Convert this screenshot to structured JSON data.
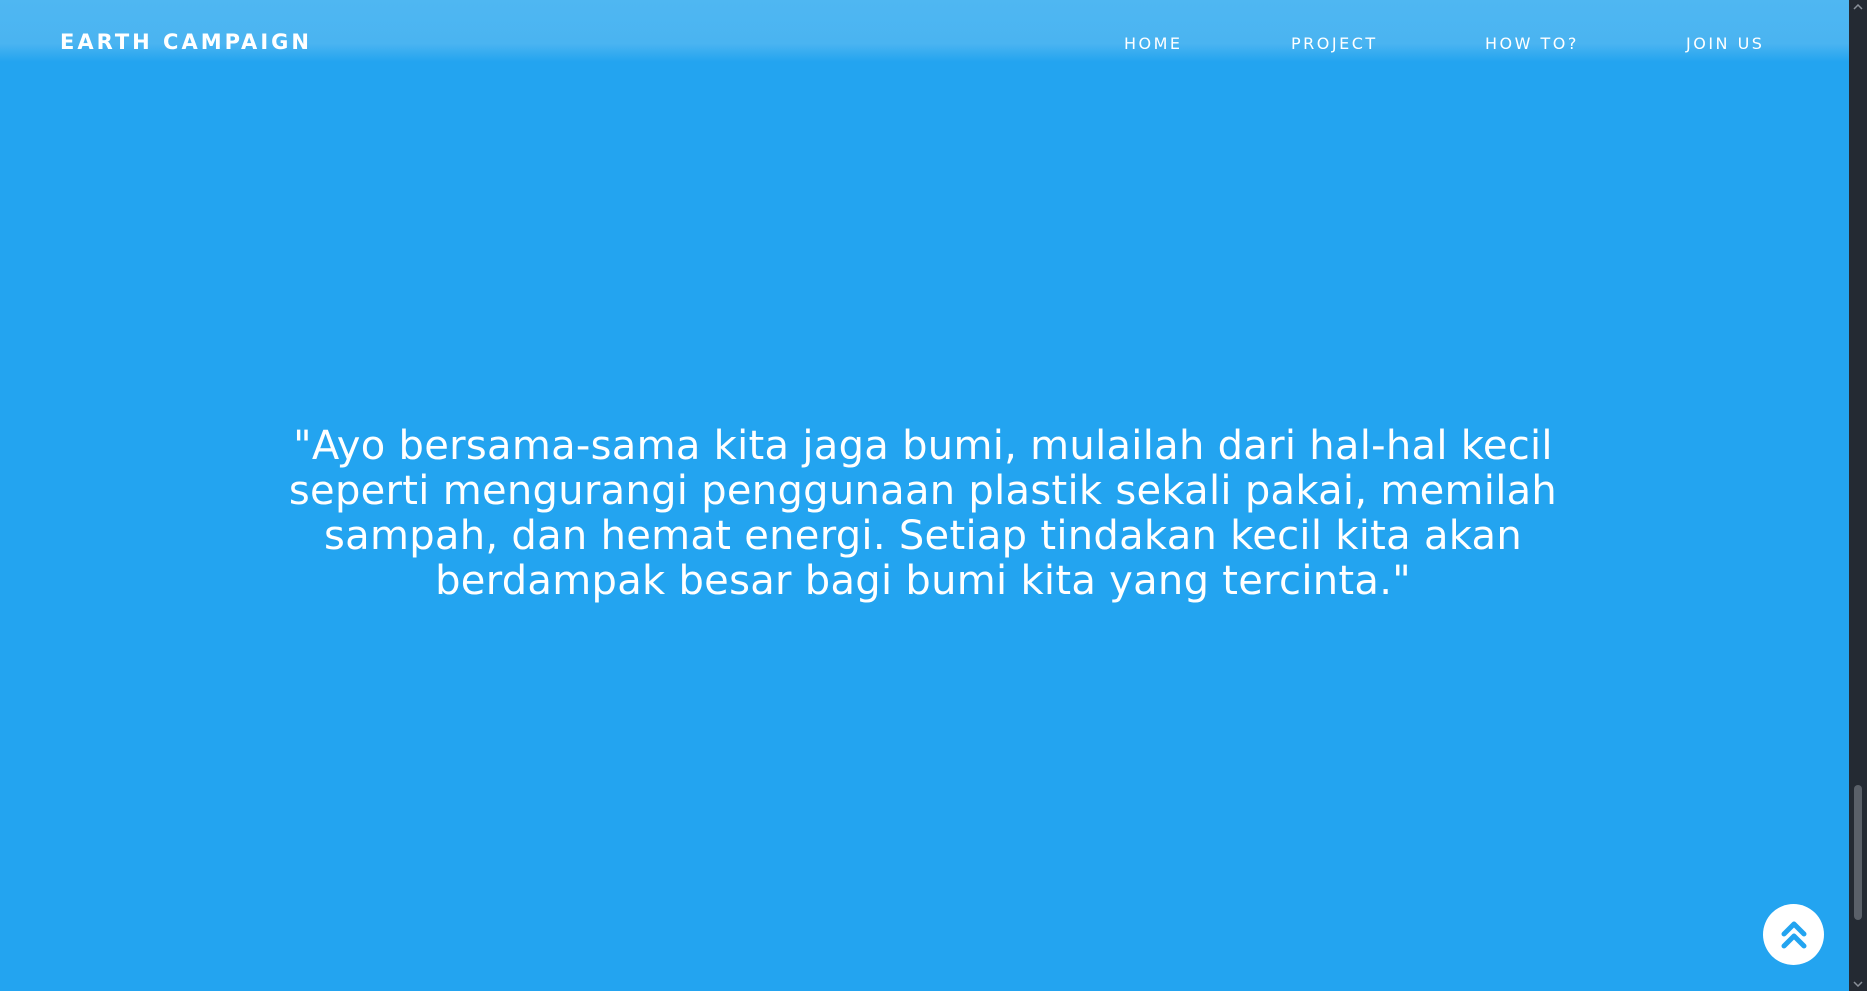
{
  "navbar": {
    "brand": "EARTH CAMPAIGN",
    "links": [
      {
        "label": "HOME"
      },
      {
        "label": "PROJECT"
      },
      {
        "label": "HOW TO?"
      },
      {
        "label": "JOIN US"
      }
    ]
  },
  "main": {
    "quote": "\"Ayo bersama-sama kita jaga bumi, mulailah dari hal-hal kecil seperti mengurangi penggunaan plastik sekali pakai, memilah sampah, dan hemat energi. Setiap tindakan kecil kita akan berdampak besar bagi bumi kita yang tercinta.\""
  },
  "back_to_top": {
    "icon": "double-chevron-up-icon"
  },
  "colors": {
    "background": "#23a4f0",
    "navbar": "#4ab4f1",
    "text": "#ffffff",
    "scrollbar_track": "#242a33",
    "scrollbar_thumb": "#5a6069"
  }
}
